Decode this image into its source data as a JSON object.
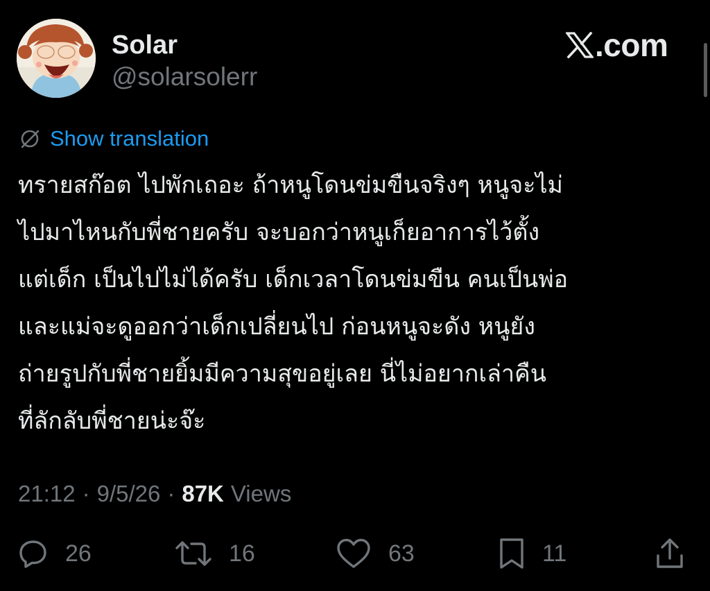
{
  "author": {
    "name": "Solar",
    "handle": "@solarsolerr"
  },
  "brand": {
    "logo_text": ".com",
    "logo_icon": "x-logo-icon"
  },
  "translation": {
    "icon": "globe-slash-icon",
    "link_label": "Show translation"
  },
  "tweet": {
    "lines": [
      "ทรายสก๊อต ไปพักเถอะ ถ้าหนูโดนข่มขืนจริงๆ หนูจะไม่",
      "ไปมาไหนกับพี่ชายครับ จะบอกว่าหนูเก็ยอาการไว้ตั้ง",
      "แต่เด็ก เป็นไปไม่ได้ครับ เด็กเวลาโดนข่มขืน คนเป็นพ่อ",
      "และแม่จะดูออกว่าเด็กเปลี่ยนไป ก่อนหนูจะดัง หนูยัง",
      "ถ่ายรูปกับพี่ชายยิ้มมีความสุขอยู่เลย นี่ไม่อยากเล่าคืน",
      "ที่ลักลับพี่ชายน่ะจ๊ะ"
    ]
  },
  "meta": {
    "time": "21:12",
    "separator": "·",
    "date": "9/5/26",
    "views_count": "87K",
    "views_label": "Views"
  },
  "actions": {
    "reply": {
      "icon": "reply-icon",
      "count": "26"
    },
    "repost": {
      "icon": "repost-icon",
      "count": "16"
    },
    "like": {
      "icon": "heart-icon",
      "count": "63"
    },
    "bookmark": {
      "icon": "bookmark-icon",
      "count": "11"
    },
    "share": {
      "icon": "share-icon"
    }
  },
  "colors": {
    "background": "#000000",
    "text_primary": "#e7e9ea",
    "text_secondary": "#71767b",
    "link": "#1d9bf0"
  }
}
